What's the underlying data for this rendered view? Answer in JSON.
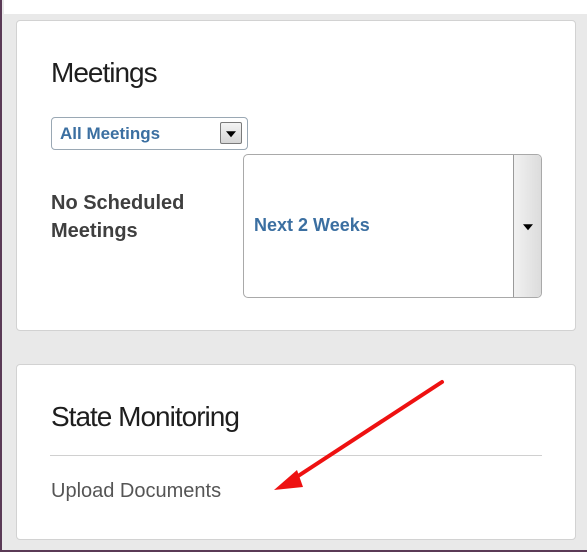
{
  "meetings_panel": {
    "title": "Meetings",
    "filter_select": {
      "selected": "All Meetings"
    },
    "empty_message": "No Scheduled Meetings",
    "range_select": {
      "selected": "Next 2 Weeks"
    }
  },
  "monitoring_panel": {
    "title": "State Monitoring",
    "upload_link": "Upload Documents"
  },
  "annotation": {
    "arrow_color": "#ee1111"
  },
  "colors": {
    "link_blue": "#3b6fa1",
    "frame_border": "#5a3a56",
    "background": "#e9e9e9"
  }
}
